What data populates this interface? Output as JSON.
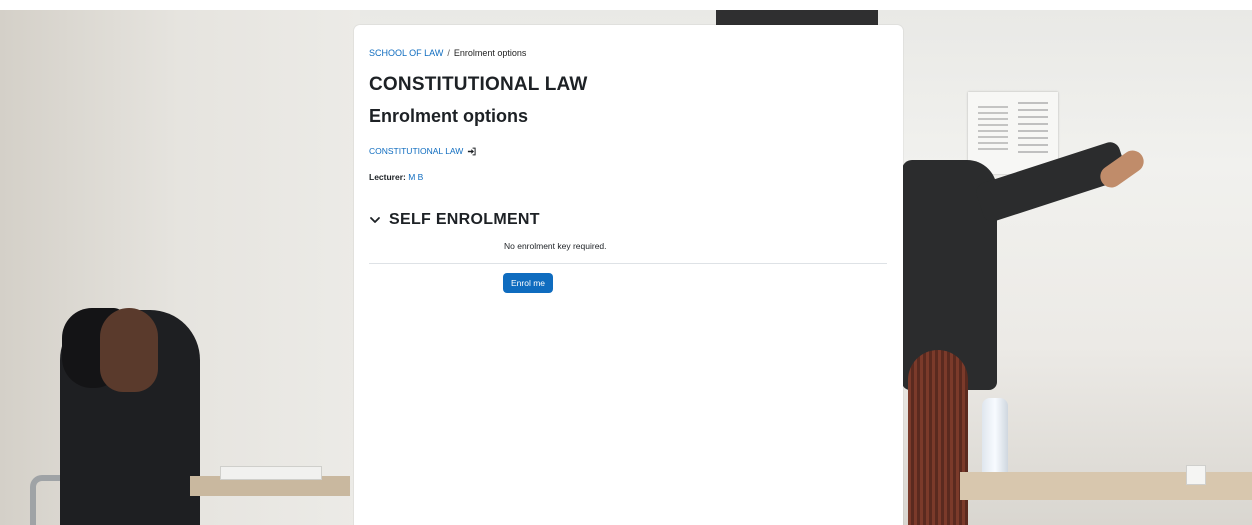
{
  "breadcrumb": {
    "parent": "SCHOOL OF LAW",
    "separator": "/",
    "current": "Enrolment options"
  },
  "course_title": "CONSTITUTIONAL LAW",
  "page_title": "Enrolment options",
  "course_link": {
    "label": "CONSTITUTIONAL LAW",
    "icon": "sign-in-icon"
  },
  "lecturer": {
    "label": "Lecturer:",
    "name": "M B"
  },
  "self_enrolment": {
    "heading": "SELF ENROLMENT",
    "toggle_icon": "chevron-down-icon",
    "note": "No enrolment key required.",
    "button_label": "Enrol me"
  },
  "colors": {
    "link": "#0f6cbf",
    "button": "#0f6cbf",
    "text": "#1d2125"
  }
}
